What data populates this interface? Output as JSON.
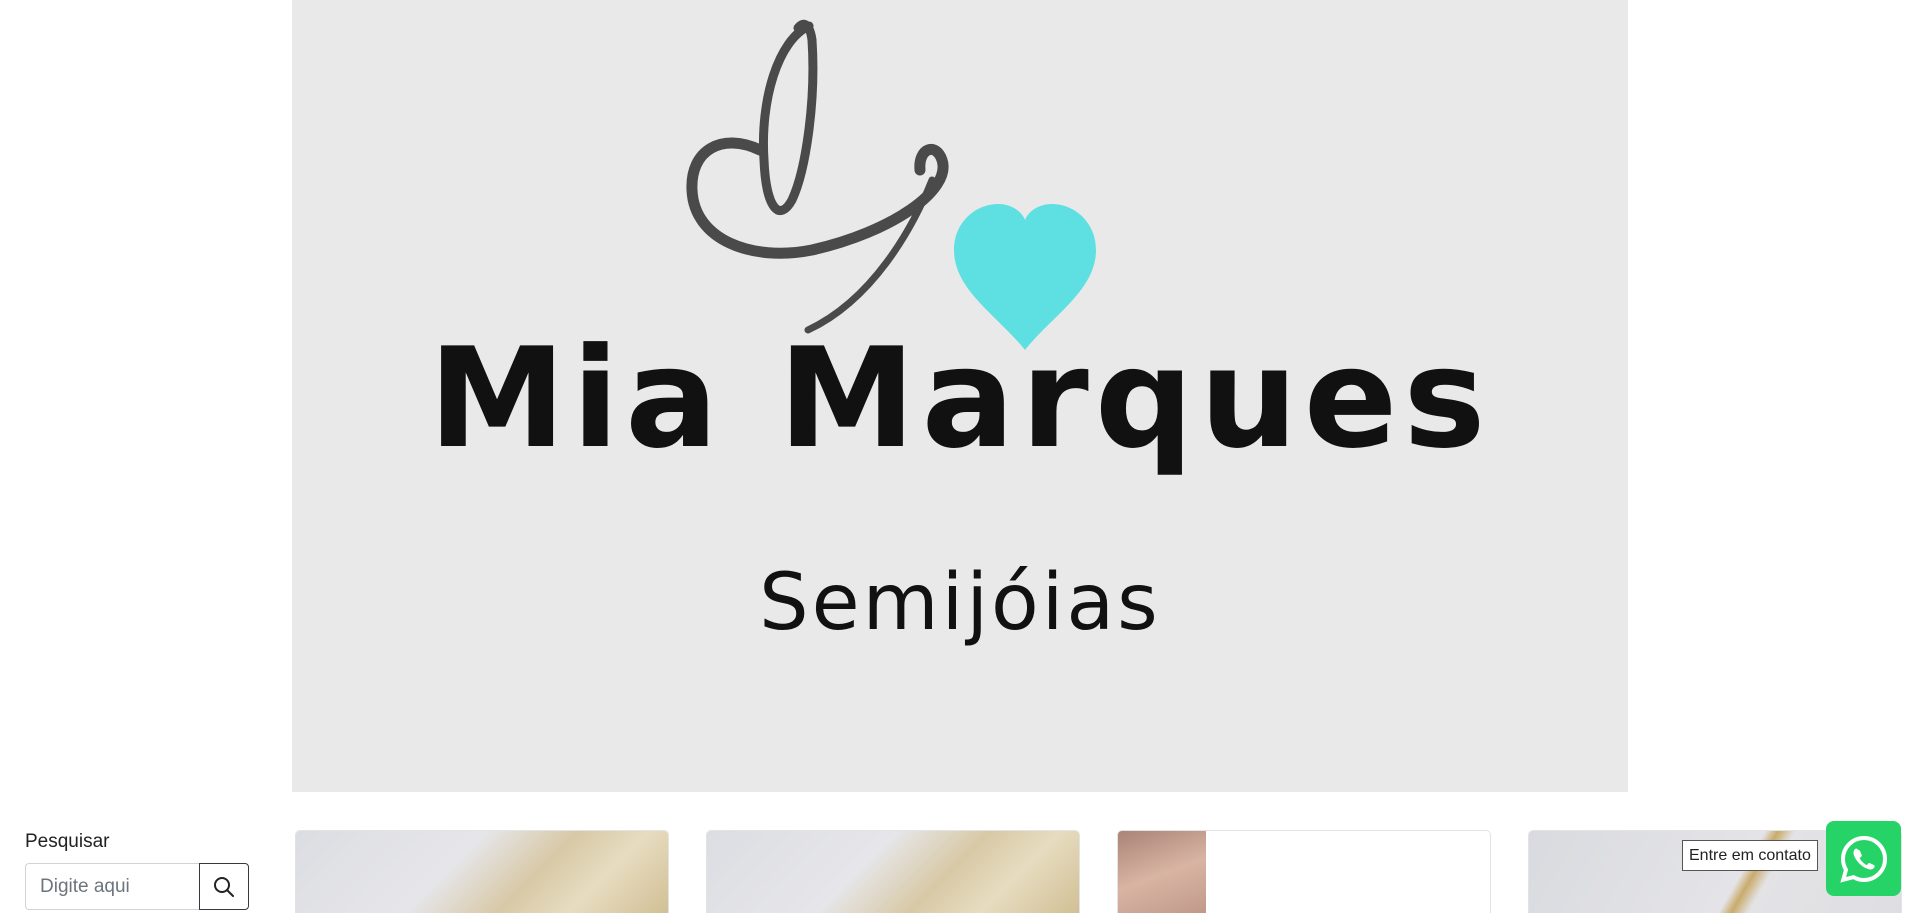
{
  "banner": {
    "brand_name": "Mia Marques",
    "brand_subtitle": "Semijóias",
    "logo_icon": "monogram-heart-logo",
    "colors": {
      "background": "#e8e9e8",
      "heart": "#5ee0e2",
      "monogram": "#4a4a4a",
      "text": "#111111"
    }
  },
  "search": {
    "label": "Pesquisar",
    "placeholder": "Digite aqui",
    "button_icon": "search-icon"
  },
  "products": [
    {
      "image": "feather-jewelry-photo"
    },
    {
      "image": "feather-jewelry-photo"
    },
    {
      "image": "hand-chain-photo"
    },
    {
      "image": "gold-chain-photo"
    }
  ],
  "contact": {
    "label": "Entre em contato",
    "icon": "whatsapp-icon",
    "color": "#25d366"
  }
}
